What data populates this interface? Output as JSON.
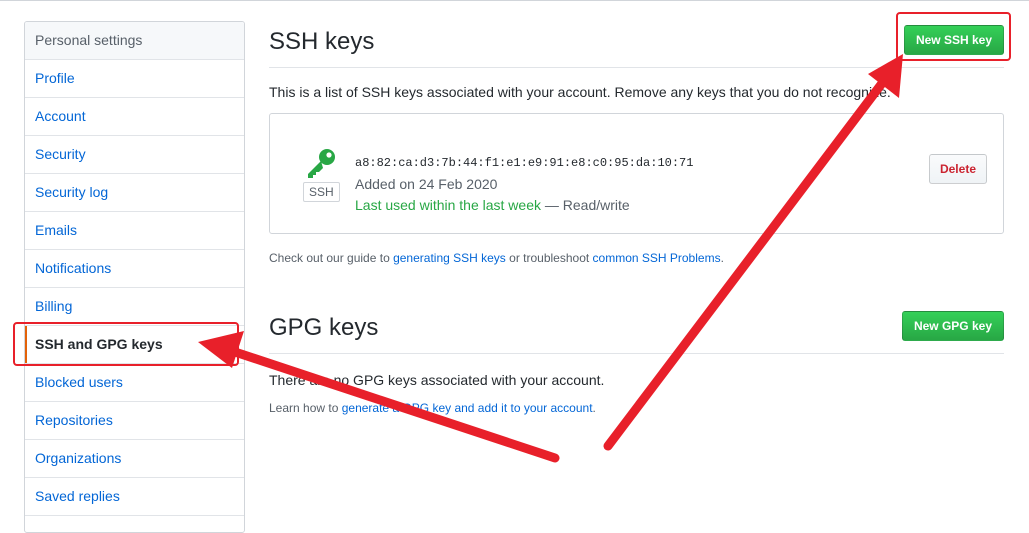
{
  "sidebar": {
    "header": "Personal settings",
    "items": [
      {
        "label": "Profile"
      },
      {
        "label": "Account"
      },
      {
        "label": "Security"
      },
      {
        "label": "Security log"
      },
      {
        "label": "Emails"
      },
      {
        "label": "Notifications"
      },
      {
        "label": "Billing"
      },
      {
        "label": "SSH and GPG keys",
        "selected": true
      },
      {
        "label": "Blocked users"
      },
      {
        "label": "Repositories"
      },
      {
        "label": "Organizations"
      },
      {
        "label": "Saved replies"
      }
    ]
  },
  "ssh": {
    "title": "SSH keys",
    "new_button": "New SSH key",
    "intro": "This is a list of SSH keys associated with your account. Remove any keys that you do not recognize.",
    "key": {
      "title": "",
      "fingerprint": "a8:82:ca:d3:7b:44:f1:e1:e9:91:e8:c0:95:da:10:71",
      "added": "Added on 24 Feb 2020",
      "last_used": "Last used within the last week",
      "access": " — Read/write",
      "badge": "SSH",
      "delete_label": "Delete"
    },
    "help_prefix": "Check out our guide to ",
    "help_link1": "generating SSH keys",
    "help_middle": " or troubleshoot ",
    "help_link2": "common SSH Problems",
    "help_suffix": "."
  },
  "gpg": {
    "title": "GPG keys",
    "new_button": "New GPG key",
    "empty_text": "There are no GPG keys associated with your account.",
    "help_prefix": "Learn how to ",
    "help_link": "generate a GPG key and add it to your account",
    "help_suffix": "."
  },
  "colors": {
    "accent_link": "#0366d6",
    "primary_green": "#28a745",
    "annotation_red": "#e8202a"
  }
}
